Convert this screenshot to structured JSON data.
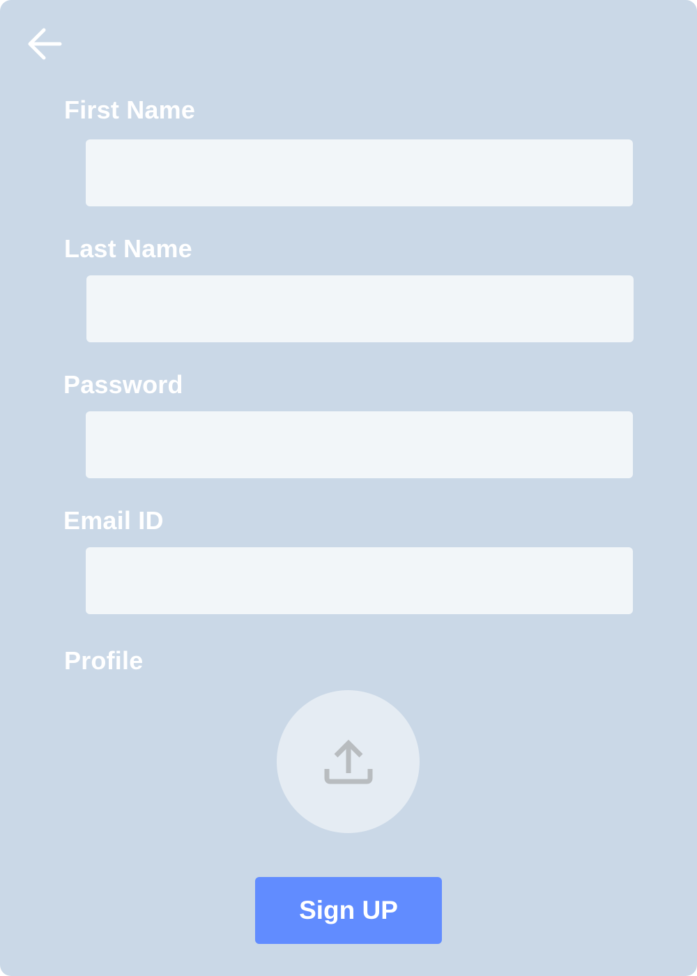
{
  "form": {
    "fields": [
      {
        "label": "First Name",
        "value": "",
        "placeholder": ""
      },
      {
        "label": "Last Name",
        "value": "",
        "placeholder": ""
      },
      {
        "label": "Password",
        "value": "",
        "placeholder": ""
      },
      {
        "label": "Email ID",
        "value": "",
        "placeholder": ""
      }
    ],
    "profile": {
      "label": "Profile",
      "icon": "upload-icon"
    },
    "submit_label": "Sign UP",
    "back_icon": "arrow-left-icon"
  },
  "colors": {
    "background": "#cad8e7",
    "input_background": "#f2f6f9",
    "upload_circle": "#e5ecf3",
    "upload_icon": "#b8bcbf",
    "accent": "#618cff",
    "label_text": "#ffffff"
  }
}
